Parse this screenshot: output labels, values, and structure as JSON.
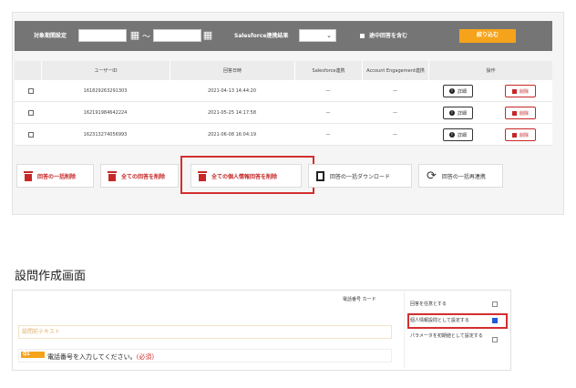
{
  "filter": {
    "period_label": "対象期間設定",
    "tilde": "〜",
    "salesforce_label": "Salesforce連携結果",
    "include_partial_label": "途中回答を含む",
    "filter_button": "絞り込む"
  },
  "table": {
    "headers": [
      "ユーザーID",
      "回答日時",
      "Salesforce連携",
      "Account Engagement連携",
      "操作"
    ],
    "rows": [
      {
        "user_id": "161829263291303",
        "answered_at": "2021-04-13 14:44:20",
        "salesforce": "—",
        "account_engagement": "—"
      },
      {
        "user_id": "162191984642224",
        "answered_at": "2021-05-25 14:17:58",
        "salesforce": "—",
        "account_engagement": "—"
      },
      {
        "user_id": "162313274056993",
        "answered_at": "2021-06-08 16:04:19",
        "salesforce": "—",
        "account_engagement": "—"
      }
    ],
    "detail_label": "詳細",
    "delete_label": "削除"
  },
  "actions": {
    "bulk_delete": "回答の一括削除",
    "delete_all": "全ての回答を削除",
    "delete_all_personal": "全ての個人情報回答を削除",
    "bulk_download": "回答の一括ダウンロード",
    "bulk_resync": "回答の一括再連携"
  },
  "section": {
    "title": "設問作成画面",
    "tab_label": "電話番号 カード",
    "pre_text": "設問前テキスト",
    "question_badge": "Q1",
    "question_text": "電話番号を入力してください。",
    "question_required": "(必須)",
    "options": [
      {
        "label": "回答を任意とする",
        "checked": false
      },
      {
        "label": "個人情報設問として設定する",
        "checked": true
      },
      {
        "label": "パラメータを初期値として設定する",
        "checked": false
      }
    ]
  },
  "colors": {
    "accent": "#f4a31b",
    "danger": "#c62828",
    "highlight": "#d32f2f"
  }
}
